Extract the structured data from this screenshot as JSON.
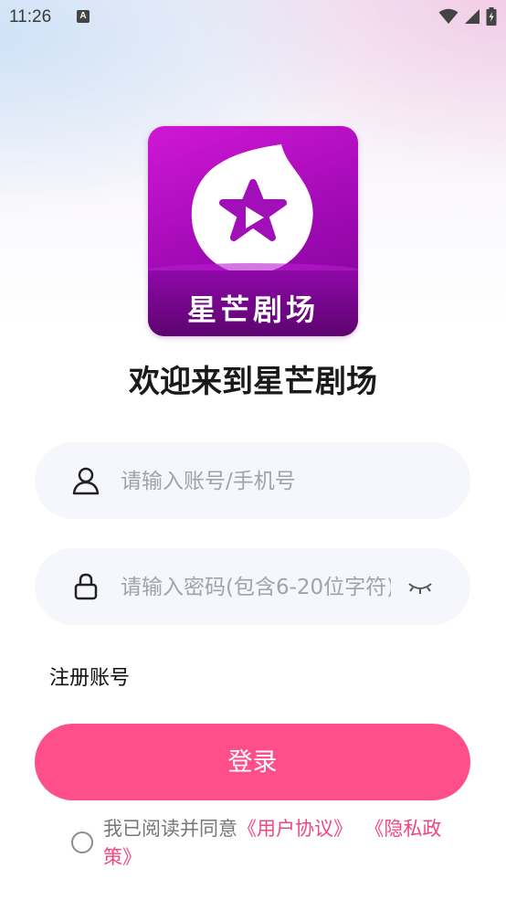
{
  "status_bar": {
    "time": "11:26",
    "notification_icon": "A",
    "icons": [
      "wifi-icon",
      "signal-icon",
      "battery-charging-icon"
    ]
  },
  "logo": {
    "brand_text": "星芒剧场",
    "icon": "star-play-icon"
  },
  "welcome_title": "欢迎来到星芒剧场",
  "account_field": {
    "icon": "user-icon",
    "placeholder": "请输入账号/手机号",
    "value": ""
  },
  "password_field": {
    "icon": "lock-icon",
    "placeholder": "请输入密码(包含6-20位字符)",
    "value": "",
    "toggle_icon": "eye-closed-icon"
  },
  "register_link": "注册账号",
  "login_button": "登录",
  "agreement": {
    "prefix": "我已阅读并同意",
    "user_agreement": "《用户协议》",
    "privacy_policy": "《隐私政策》",
    "checked": false
  },
  "colors": {
    "accent": "#FF4F8B",
    "link": "#F0467F",
    "logo_purple": "#B010C8",
    "field_bg": "#F5F7FC"
  }
}
